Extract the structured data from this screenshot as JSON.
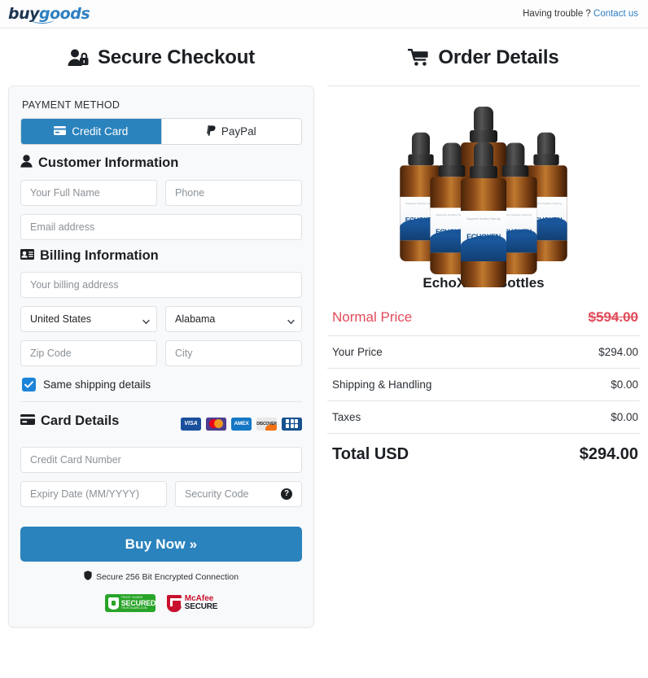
{
  "header": {
    "logo_buy": "buy",
    "logo_goods": "goods",
    "help_text": "Having trouble ?",
    "contact_link": "Contact us"
  },
  "left": {
    "title": "Secure Checkout",
    "payment_method_label": "PAYMENT METHOD",
    "tabs": [
      {
        "label": "Credit Card",
        "active": true
      },
      {
        "label": "PayPal",
        "active": false
      }
    ],
    "customer_information": {
      "heading": "Customer Information",
      "full_name_placeholder": "Your Full Name",
      "full_name_value": "",
      "phone_placeholder": "Phone",
      "phone_value": "",
      "email_placeholder": "Email address",
      "email_value": ""
    },
    "billing_information": {
      "heading": "Billing Information",
      "address_placeholder": "Your billing address",
      "address_value": "",
      "country_selected": "United States",
      "state_selected": "Alabama",
      "zip_placeholder": "Zip Code",
      "zip_value": "",
      "city_placeholder": "City",
      "city_value": ""
    },
    "same_shipping_label": "Same shipping details",
    "same_shipping_checked": true,
    "card_details": {
      "heading": "Card Details",
      "brands": [
        "VISA",
        "Mastercard",
        "AMEX",
        "DISCOVER",
        "JCB"
      ],
      "brand_visa_text": "VISA",
      "brand_amex_text": "AMEX",
      "brand_discover_text": "DISCOVER",
      "number_placeholder": "Credit Card Number",
      "number_value": "",
      "expiry_placeholder": "Expiry Date (MM/YYYY)",
      "expiry_value": "",
      "cvv_placeholder": "Security Code",
      "cvv_value": "",
      "cvv_help_glyph": "?"
    },
    "buy_button": "Buy Now »",
    "secure_note": "Secure 256 Bit Encrypted Connection",
    "trust_badge": {
      "top": "TRUST GUARD",
      "main": "SECURED",
      "bottom": "TRUSTGUARD.COM"
    },
    "mcafee_badge": {
      "line1": "McAfee",
      "line2": "SECURE"
    }
  },
  "right": {
    "title": "Order Details",
    "product_name": "EchoXen 6 Bottles",
    "bottle_label_name": "ECHOXEN",
    "bottle_label_sub": "Supports Healthy Hearing",
    "summary": [
      {
        "label": "Normal Price",
        "amount": "$594.00",
        "style": "normal"
      },
      {
        "label": "Your Price",
        "amount": "$294.00",
        "style": "line"
      },
      {
        "label": "Shipping & Handling",
        "amount": "$0.00",
        "style": "line"
      },
      {
        "label": "Taxes",
        "amount": "$0.00",
        "style": "line"
      },
      {
        "label": "Total USD",
        "amount": "$294.00",
        "style": "total"
      }
    ]
  },
  "colors": {
    "accent_blue": "#2a83bd",
    "link_blue": "#2f7fc1",
    "price_red": "#e04a59",
    "checkbox_blue": "#1b84d8",
    "card_bg": "#f8f9fa"
  }
}
